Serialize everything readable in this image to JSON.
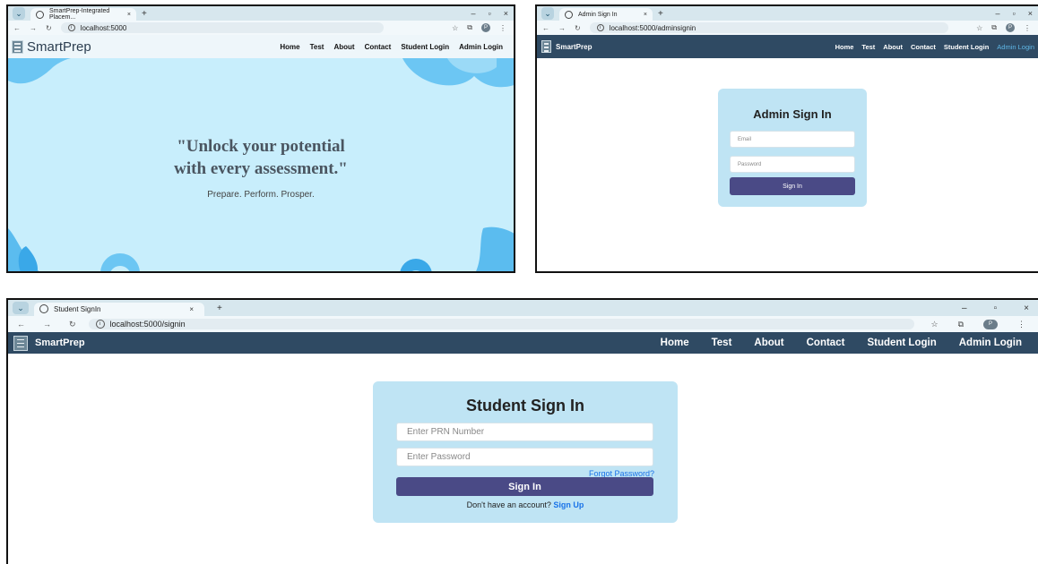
{
  "home": {
    "tab_title": "SmartPrep-Integrated Placem...",
    "url": "localhost:5000",
    "brand": "SmartPrep",
    "nav": [
      "Home",
      "Test",
      "About",
      "Contact",
      "Student Login",
      "Admin Login"
    ],
    "quote_line1": "\"Unlock your potential",
    "quote_line2": "with every assessment.\"",
    "tagline": "Prepare. Perform. Prosper."
  },
  "admin": {
    "tab_title": "Admin Sign In",
    "url": "localhost:5000/adminsignin",
    "brand": "SmartPrep",
    "nav": [
      "Home",
      "Test",
      "About",
      "Contact",
      "Student Login",
      "Admin Login"
    ],
    "title": "Admin Sign In",
    "email_placeholder": "Email",
    "password_placeholder": "Password",
    "signin_label": "Sign In"
  },
  "student": {
    "tab_title": "Student SignIn",
    "url": "localhost:5000/signin",
    "brand": "SmartPrep",
    "nav": [
      "Home",
      "Test",
      "About",
      "Contact",
      "Student Login",
      "Admin Login"
    ],
    "title": "Student Sign In",
    "prn_placeholder": "Enter PRN Number",
    "password_placeholder": "Enter Password",
    "forgot_label": "Forgot Password?",
    "signin_label": "Sign In",
    "no_account_text": "Don't have an account?",
    "signup_label": "Sign Up"
  },
  "colors": {
    "navbar_dark": "#2f4a63",
    "hero_bg": "#c8eefc",
    "card_bg": "#bfe4f4",
    "button": "#4a4a86",
    "link": "#1a73e8",
    "active_nav": "#5fb7e6"
  }
}
